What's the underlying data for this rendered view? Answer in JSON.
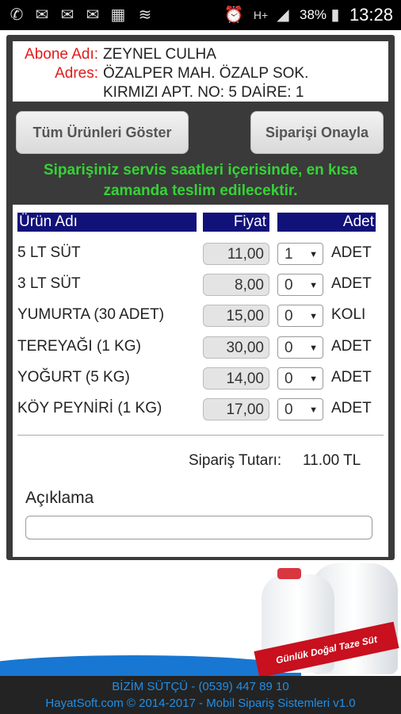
{
  "status_bar": {
    "icons": [
      "whatsapp-icon",
      "messages-icon",
      "messages-icon",
      "messages-icon",
      "image-icon",
      "wifi-calling-icon"
    ],
    "right_icons": [
      "alarm-icon",
      "hplus-icon",
      "signal-icon"
    ],
    "battery": "38%",
    "time": "13:28"
  },
  "customer": {
    "name_label": "Abone Adı:",
    "name": "ZEYNEL CULHA",
    "address_label": "Adres:",
    "address_line1": "ÖZALPER MAH. ÖZALP SOK.",
    "address_line2": "KIRMIZI APT. NO: 5 DAİRE: 1"
  },
  "buttons": {
    "show_all": "Tüm Ürünleri Göster",
    "confirm": "Siparişi Onayla"
  },
  "notice": {
    "line1": "Siparişiniz servis saatleri içerisinde, en kısa",
    "line2": "zamanda teslim edilecektir."
  },
  "table": {
    "headers": {
      "product": "Ürün Adı",
      "price": "Fiyat",
      "qty": "Adet"
    },
    "rows": [
      {
        "name": "5 LT SÜT",
        "price": "11,00",
        "qty": "1",
        "unit": "ADET"
      },
      {
        "name": "3 LT SÜT",
        "price": "8,00",
        "qty": "0",
        "unit": "ADET"
      },
      {
        "name": "YUMURTA (30 ADET)",
        "price": "15,00",
        "qty": "0",
        "unit": "KOLI"
      },
      {
        "name": "TEREYAĞI (1 KG)",
        "price": "30,00",
        "qty": "0",
        "unit": "ADET"
      },
      {
        "name": "YOĞURT (5 KG)",
        "price": "14,00",
        "qty": "0",
        "unit": "ADET"
      },
      {
        "name": "KÖY PEYNİRİ (1 KG)",
        "price": "17,00",
        "qty": "0",
        "unit": "ADET"
      }
    ]
  },
  "order": {
    "total_label": "Sipariş Tutarı:",
    "total_value": "11.00 TL",
    "note_label": "Açıklama",
    "note_value": ""
  },
  "promo": {
    "ribbon_text": "Günlük Doğal Taze Süt"
  },
  "footer": {
    "line1": "BİZİM SÜTÇÜ - (0539) 447 89 10",
    "line2": "HayatSoft.com © 2014-2017 - Mobil Sipariş Sistemleri v1.0"
  },
  "colors": {
    "label_red": "#e21b1b",
    "notice_green": "#35d335",
    "header_navy": "#11117a",
    "footer_blue": "#1f8fe8"
  }
}
